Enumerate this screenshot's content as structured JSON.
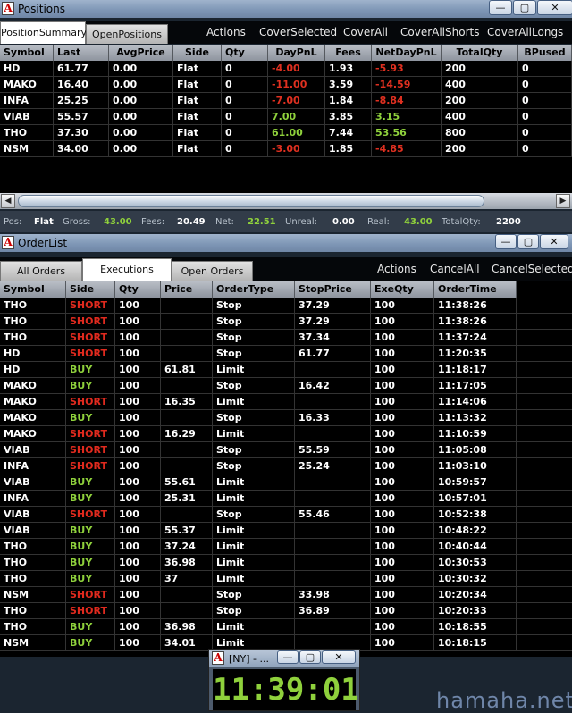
{
  "positions_window": {
    "title": "Positions",
    "tabs": [
      "PositionSummary",
      "OpenPositions"
    ],
    "actions": [
      "Actions",
      "CoverSelected",
      "CoverAll",
      "CoverAllShorts",
      "CoverAllLongs"
    ],
    "columns": [
      "Symbol",
      "Last",
      "AvgPrice",
      "Side",
      "Qty",
      "DayPnL",
      "Fees",
      "NetDayPnL",
      "TotalQty",
      "BPused"
    ],
    "rows": [
      [
        "HD",
        "61.77",
        "0.00",
        "Flat",
        "0",
        "-4.00",
        "1.93",
        "-5.93",
        "200",
        "0"
      ],
      [
        "MAKO",
        "16.40",
        "0.00",
        "Flat",
        "0",
        "-11.00",
        "3.59",
        "-14.59",
        "400",
        "0"
      ],
      [
        "INFA",
        "25.25",
        "0.00",
        "Flat",
        "0",
        "-7.00",
        "1.84",
        "-8.84",
        "200",
        "0"
      ],
      [
        "VIAB",
        "55.57",
        "0.00",
        "Flat",
        "0",
        "7.00",
        "3.85",
        "3.15",
        "400",
        "0"
      ],
      [
        "THO",
        "37.30",
        "0.00",
        "Flat",
        "0",
        "61.00",
        "7.44",
        "53.56",
        "800",
        "0"
      ],
      [
        "NSM",
        "34.00",
        "0.00",
        "Flat",
        "0",
        "-3.00",
        "1.85",
        "-4.85",
        "200",
        "0"
      ]
    ],
    "status": {
      "pos_label": "Pos:",
      "pos_value": "Flat",
      "gross_label": "Gross:",
      "gross_value": "43.00",
      "fees_label": "Fees:",
      "fees_value": "20.49",
      "net_label": "Net:",
      "net_value": "22.51",
      "unreal_label": "Unreal:",
      "unreal_value": "0.00",
      "real_label": "Real:",
      "real_value": "43.00",
      "totalqty_label": "TotalQty:",
      "totalqty_value": "2200"
    }
  },
  "orderlist_window": {
    "title": "OrderList",
    "tabs": [
      "All Orders",
      "Executions",
      "Open Orders"
    ],
    "actions": [
      "Actions",
      "CancelAll",
      "CancelSelected"
    ],
    "columns": [
      "Symbol",
      "Side",
      "Qty",
      "Price",
      "OrderType",
      "StopPrice",
      "ExeQty",
      "OrderTime"
    ],
    "rows": [
      [
        "THO",
        "SHORT",
        "100",
        "",
        "Stop",
        "37.29",
        "100",
        "11:38:26"
      ],
      [
        "THO",
        "SHORT",
        "100",
        "",
        "Stop",
        "37.29",
        "100",
        "11:38:26"
      ],
      [
        "THO",
        "SHORT",
        "100",
        "",
        "Stop",
        "37.34",
        "100",
        "11:37:24"
      ],
      [
        "HD",
        "SHORT",
        "100",
        "",
        "Stop",
        "61.77",
        "100",
        "11:20:35"
      ],
      [
        "HD",
        "BUY",
        "100",
        "61.81",
        "Limit",
        "",
        "100",
        "11:18:17"
      ],
      [
        "MAKO",
        "BUY",
        "100",
        "",
        "Stop",
        "16.42",
        "100",
        "11:17:05"
      ],
      [
        "MAKO",
        "SHORT",
        "100",
        "16.35",
        "Limit",
        "",
        "100",
        "11:14:06"
      ],
      [
        "MAKO",
        "BUY",
        "100",
        "",
        "Stop",
        "16.33",
        "100",
        "11:13:32"
      ],
      [
        "MAKO",
        "SHORT",
        "100",
        "16.29",
        "Limit",
        "",
        "100",
        "11:10:59"
      ],
      [
        "VIAB",
        "SHORT",
        "100",
        "",
        "Stop",
        "55.59",
        "100",
        "11:05:08"
      ],
      [
        "INFA",
        "SHORT",
        "100",
        "",
        "Stop",
        "25.24",
        "100",
        "11:03:10"
      ],
      [
        "VIAB",
        "BUY",
        "100",
        "55.61",
        "Limit",
        "",
        "100",
        "10:59:57"
      ],
      [
        "INFA",
        "BUY",
        "100",
        "25.31",
        "Limit",
        "",
        "100",
        "10:57:01"
      ],
      [
        "VIAB",
        "SHORT",
        "100",
        "",
        "Stop",
        "55.46",
        "100",
        "10:52:38"
      ],
      [
        "VIAB",
        "BUY",
        "100",
        "55.37",
        "Limit",
        "",
        "100",
        "10:48:22"
      ],
      [
        "THO",
        "BUY",
        "100",
        "37.24",
        "Limit",
        "",
        "100",
        "10:40:44"
      ],
      [
        "THO",
        "BUY",
        "100",
        "36.98",
        "Limit",
        "",
        "100",
        "10:30:53"
      ],
      [
        "THO",
        "BUY",
        "100",
        "37",
        "Limit",
        "",
        "100",
        "10:30:32"
      ],
      [
        "NSM",
        "SHORT",
        "100",
        "",
        "Stop",
        "33.98",
        "100",
        "10:20:34"
      ],
      [
        "THO",
        "SHORT",
        "100",
        "",
        "Stop",
        "36.89",
        "100",
        "10:20:33"
      ],
      [
        "THO",
        "BUY",
        "100",
        "36.98",
        "Limit",
        "",
        "100",
        "10:18:55"
      ],
      [
        "NSM",
        "BUY",
        "100",
        "34.01",
        "Limit",
        "",
        "100",
        "10:18:15"
      ]
    ]
  },
  "clock_window": {
    "title": "[NY] - ...",
    "time": "11:39:01"
  },
  "watermark": "hamaha.net",
  "colors": {
    "negative": "#e03020",
    "positive": "#8fd13c",
    "short": "#e02a1e",
    "buy": "#8fd13c",
    "titlebar": "#8fa2bb"
  },
  "icons": {
    "app": "app-a-icon",
    "minimize": "minimize-icon",
    "maximize": "maximize-icon",
    "close": "close-icon",
    "scroll_left": "arrow-left-icon",
    "scroll_right": "arrow-right-icon"
  }
}
